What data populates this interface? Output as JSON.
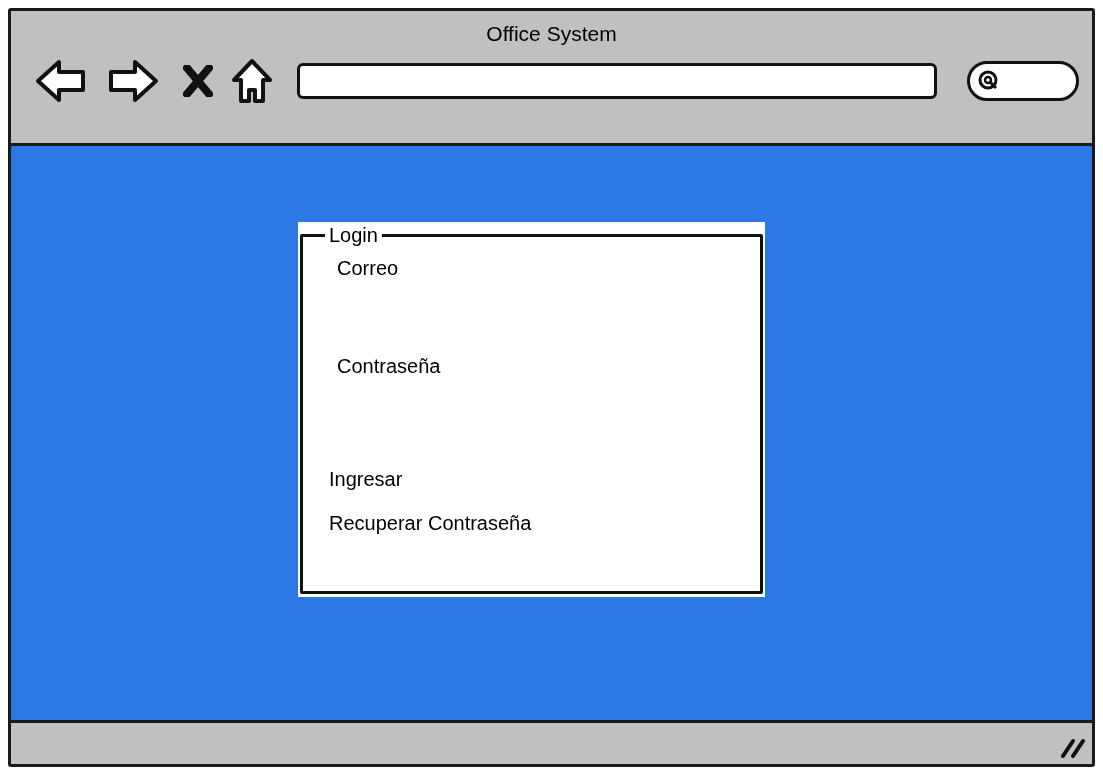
{
  "window": {
    "title": "Office System"
  },
  "login": {
    "legend": "Login",
    "items": [
      {
        "kind": "label",
        "text": "Correo"
      },
      {
        "kind": "label",
        "text": "Contraseña"
      },
      {
        "kind": "link",
        "text": "Ingresar"
      },
      {
        "kind": "link",
        "text": "Recuperar Contraseña"
      }
    ]
  }
}
